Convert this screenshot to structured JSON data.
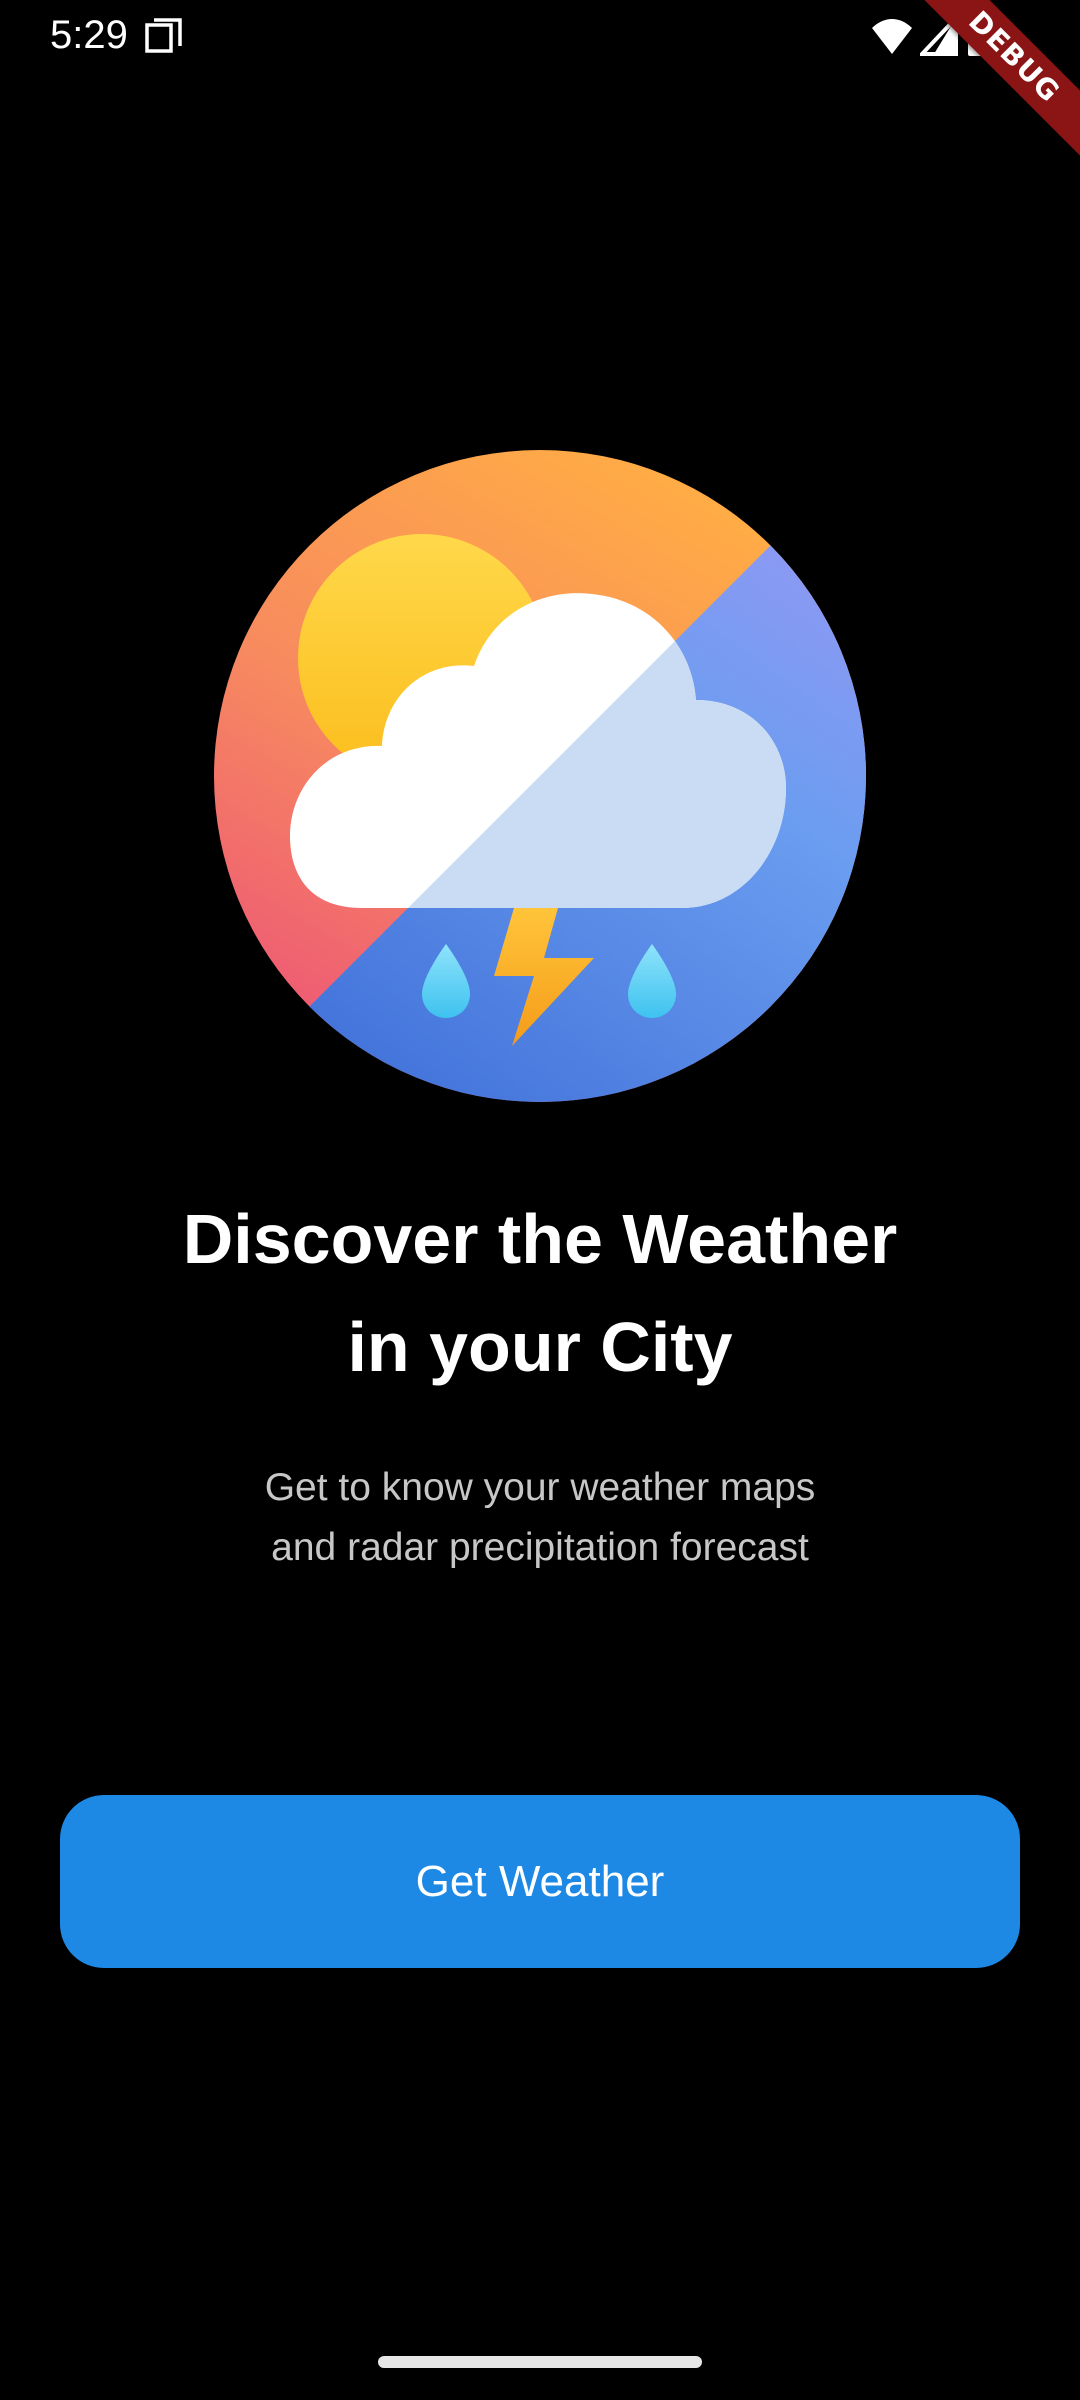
{
  "status_bar": {
    "time": "5:29",
    "icons": [
      "screen-record-icon",
      "wifi-icon",
      "cellular-signal-icon",
      "battery-icon"
    ]
  },
  "debug_banner": {
    "label": "DEBUG"
  },
  "hero": {
    "icon": "weather-thunderstorm-icon"
  },
  "onboarding": {
    "title_line1": "Discover the Weather",
    "title_line2": "in your City",
    "subtitle_line1": "Get to know your weather maps",
    "subtitle_line2": "and radar precipitation forecast",
    "button_label": "Get Weather"
  },
  "colors": {
    "background": "#000000",
    "button": "#1e88e5",
    "subtitle_text": "#c7c7c7",
    "debug_banner": "#8b1414"
  }
}
